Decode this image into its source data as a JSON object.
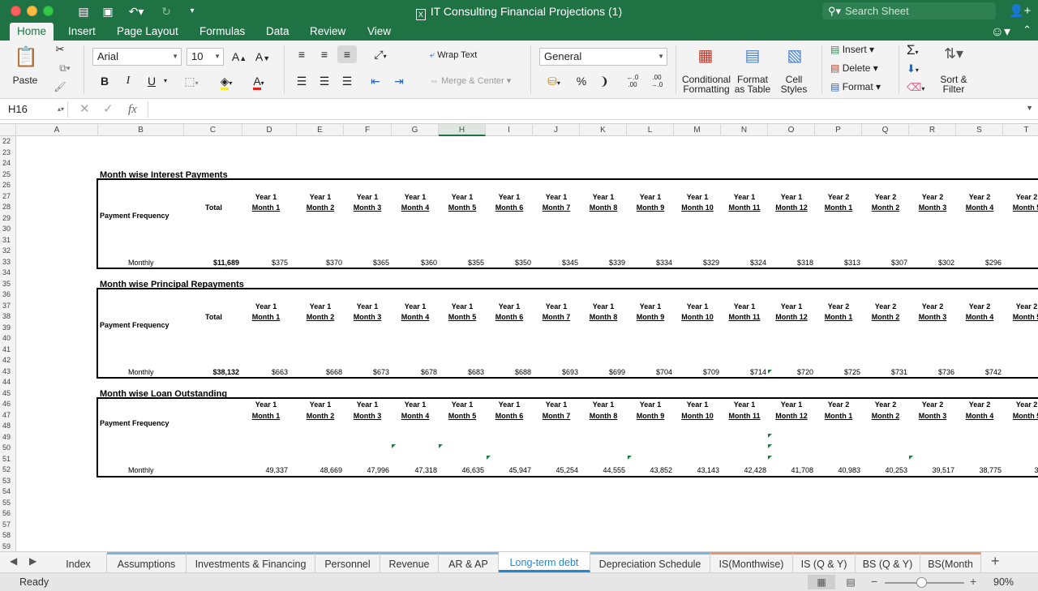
{
  "window": {
    "title": "IT Consulting  Financial Projections (1)",
    "search_placeholder": "Search Sheet"
  },
  "ribbon_tabs": [
    "Home",
    "Insert",
    "Page Layout",
    "Formulas",
    "Data",
    "Review",
    "View"
  ],
  "ribbon": {
    "paste": "Paste",
    "font_name": "Arial",
    "font_size": "10",
    "bold": "B",
    "italic": "I",
    "underline": "U",
    "wrap_text": "Wrap Text",
    "merge_center": "Merge & Center",
    "number_format": "General",
    "percent": "%",
    "conditional_formatting": [
      "Conditional",
      "Formatting"
    ],
    "format_as_table": [
      "Format",
      "as Table"
    ],
    "cell_styles": [
      "Cell",
      "Styles"
    ],
    "insert": "Insert",
    "delete": "Delete",
    "format": "Format",
    "sort_filter": [
      "Sort &",
      "Filter"
    ]
  },
  "formula_bar": {
    "cell_ref": "H16",
    "formula": ""
  },
  "columns": [
    "A",
    "B",
    "C",
    "D",
    "E",
    "F",
    "G",
    "H",
    "I",
    "J",
    "K",
    "L",
    "M",
    "N",
    "O",
    "P",
    "Q",
    "R",
    "S",
    "T"
  ],
  "selected_column": "H",
  "rows": [
    "22",
    "23",
    "24",
    "25",
    "26",
    "27",
    "28",
    "29",
    "30",
    "31",
    "32",
    "33",
    "34",
    "35",
    "36",
    "37",
    "38",
    "39",
    "40",
    "41",
    "42",
    "43",
    "44",
    "45",
    "46",
    "47",
    "48",
    "49",
    "50",
    "51",
    "52",
    "53",
    "54",
    "55",
    "56",
    "57",
    "58",
    "59"
  ],
  "period_headers": {
    "years": [
      "Year 1",
      "Year 1",
      "Year 1",
      "Year 1",
      "Year 1",
      "Year 1",
      "Year 1",
      "Year 1",
      "Year 1",
      "Year 1",
      "Year 1",
      "Year 1",
      "Year 2",
      "Year 2",
      "Year 2",
      "Year 2",
      "Year 2"
    ],
    "months": [
      "Month 1",
      "Month 2",
      "Month 3",
      "Month 4",
      "Month 5",
      "Month 6",
      "Month 7",
      "Month 8",
      "Month 9",
      "Month 10",
      "Month 11",
      "Month 12",
      "Month 1",
      "Month 2",
      "Month 3",
      "Month 4",
      "Month 5"
    ]
  },
  "sections": [
    {
      "title": "Month wise Interest Payments",
      "total_label": "Total",
      "frequency_label": "Payment Frequency",
      "row_label": "Monthly",
      "total": "$11,689",
      "values": [
        "$375",
        "$370",
        "$365",
        "$360",
        "$355",
        "$350",
        "$345",
        "$339",
        "$334",
        "$329",
        "$324",
        "$318",
        "$313",
        "$307",
        "$302",
        "$296",
        "$2"
      ]
    },
    {
      "title": "Month wise Principal Repayments",
      "total_label": "Total",
      "frequency_label": "Payment Frequency",
      "row_label": "Monthly",
      "total": "$38,132",
      "values": [
        "$663",
        "$668",
        "$673",
        "$678",
        "$683",
        "$688",
        "$693",
        "$699",
        "$704",
        "$709",
        "$714",
        "$720",
        "$725",
        "$731",
        "$736",
        "$742",
        "$7"
      ]
    },
    {
      "title": "Month wise Loan Outstanding",
      "total_label": "",
      "frequency_label": "Payment Frequency",
      "row_label": "Monthly",
      "total": "",
      "values": [
        "49,337",
        "48,669",
        "47,996",
        "47,318",
        "46,635",
        "45,947",
        "45,254",
        "44,555",
        "43,852",
        "43,143",
        "42,428",
        "41,708",
        "40,983",
        "40,253",
        "39,517",
        "38,775",
        "38,0"
      ]
    }
  ],
  "sheet_tabs": [
    "Index",
    "Assumptions",
    "Investments & Financing",
    "Personnel",
    "Revenue",
    "AR & AP",
    "Long-term debt",
    "Depreciation Schedule",
    "IS(Monthwise)",
    "IS (Q & Y)",
    "BS (Q & Y)",
    "BS(Month"
  ],
  "active_sheet_tab": "Long-term debt",
  "status": {
    "ready": "Ready",
    "zoom": "90%"
  },
  "colors": {
    "excel_green": "#1f7244",
    "active_tab_blue": "#1f88d6"
  }
}
